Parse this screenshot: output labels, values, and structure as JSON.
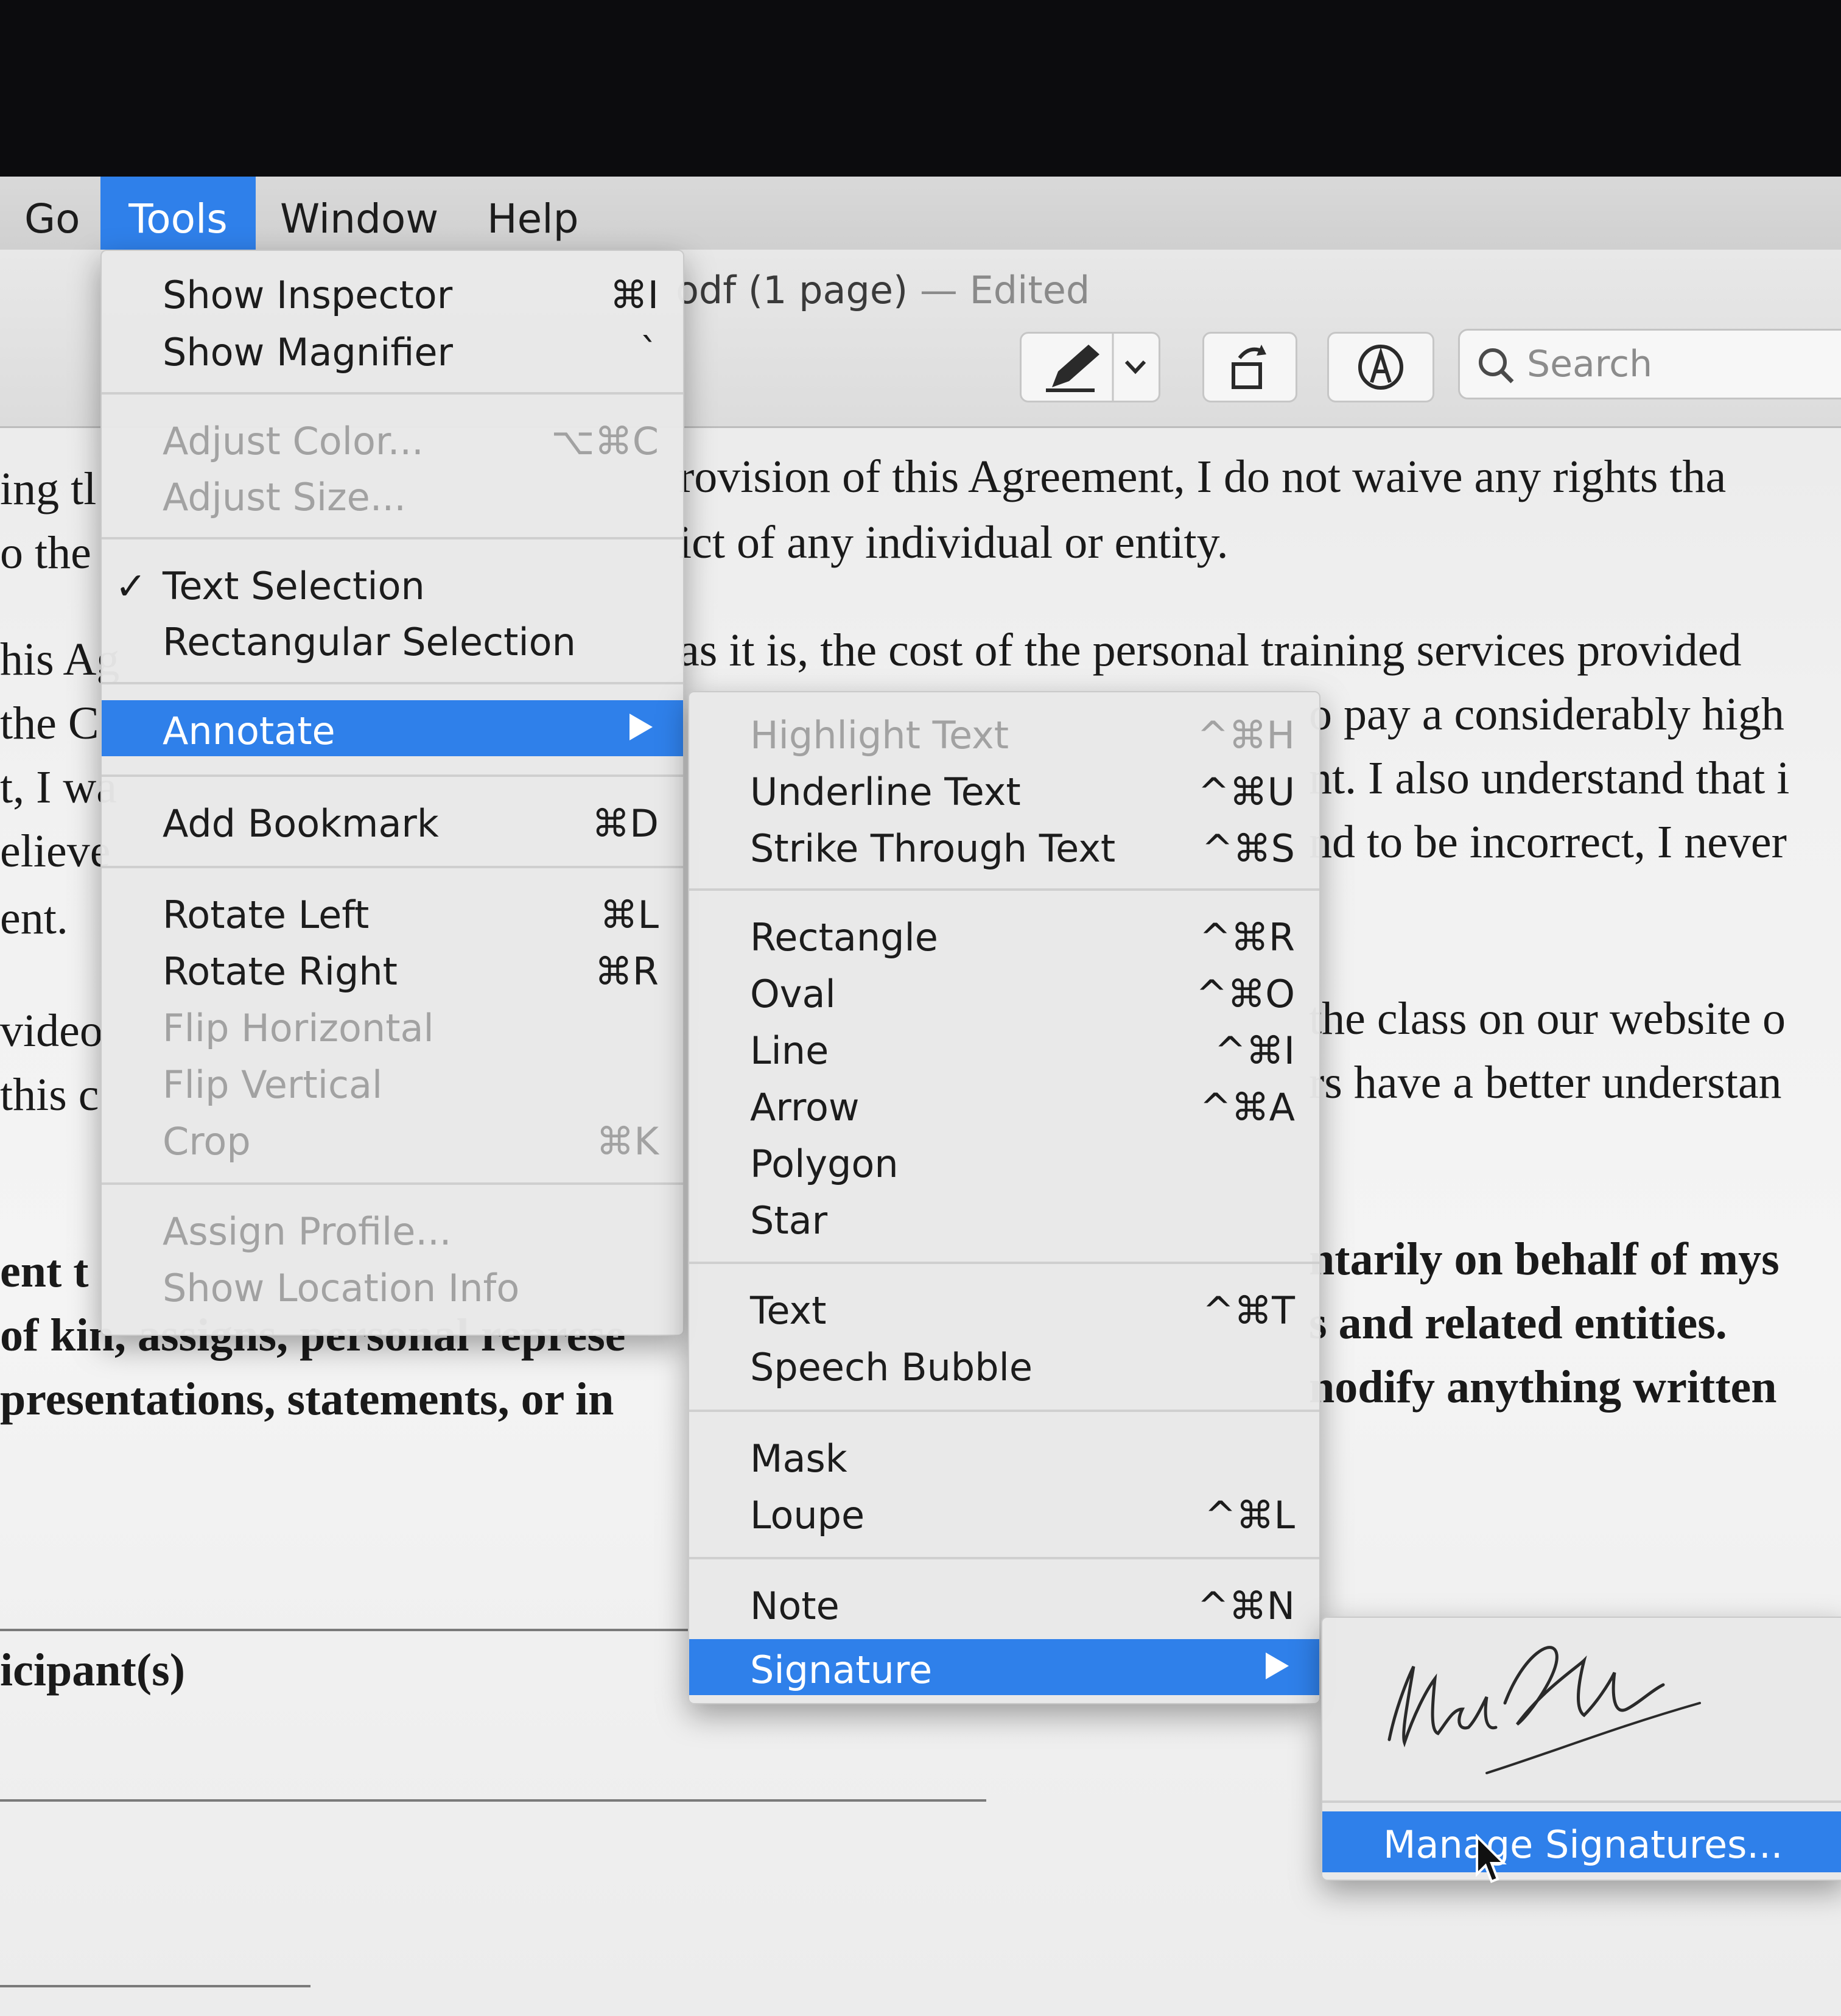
{
  "menubar": {
    "items": [
      {
        "label": "Go"
      },
      {
        "label": "Tools"
      },
      {
        "label": "Window"
      },
      {
        "label": "Help"
      }
    ]
  },
  "window": {
    "title": "odf (1 page)",
    "title_status": "— Edited",
    "search_placeholder": "Search"
  },
  "document": {
    "lines": [
      "rovision of this Agreement, I do not waive any rights tha",
      "ict of any individual or entity.",
      "as it is, the cost of the personal training services provided",
      "o pay a considerably high",
      "nt.  I also understand that i",
      "nd to be incorrect, I never",
      "the class on our website o",
      "rs have a better understan",
      "ntarily on behalf of mys",
      "s and related entities.",
      "nodify anything written",
      "ing tl",
      "o the",
      "his Ag",
      "the C",
      "t, I wa",
      "elieve",
      "ent.",
      "video",
      "this c",
      "ent t",
      "of kin, assigns, personal represe",
      "presentations, statements, or in",
      "icipant(s)"
    ]
  },
  "tools_menu": {
    "items": [
      {
        "label": "Show Inspector",
        "shortcut": "⌘I",
        "enabled": true
      },
      {
        "label": "Show Magnifier",
        "shortcut": "`",
        "enabled": true
      },
      {
        "label": "Adjust Color...",
        "shortcut": "⌥⌘C",
        "enabled": false
      },
      {
        "label": "Adjust Size...",
        "shortcut": "",
        "enabled": false
      },
      {
        "label": "Text Selection",
        "shortcut": "",
        "enabled": true,
        "checked": true
      },
      {
        "label": "Rectangular Selection",
        "shortcut": "",
        "enabled": true
      },
      {
        "label": "Annotate",
        "shortcut": "",
        "enabled": true,
        "highlighted": true
      },
      {
        "label": "Add Bookmark",
        "shortcut": "⌘D",
        "enabled": true
      },
      {
        "label": "Rotate Left",
        "shortcut": "⌘L",
        "enabled": true
      },
      {
        "label": "Rotate Right",
        "shortcut": "⌘R",
        "enabled": true
      },
      {
        "label": "Flip Horizontal",
        "shortcut": "",
        "enabled": false
      },
      {
        "label": "Flip Vertical",
        "shortcut": "",
        "enabled": false
      },
      {
        "label": "Crop",
        "shortcut": "⌘K",
        "enabled": false
      },
      {
        "label": "Assign Profile...",
        "shortcut": "",
        "enabled": false
      },
      {
        "label": "Show Location Info",
        "shortcut": "",
        "enabled": false
      }
    ]
  },
  "annotate_menu": {
    "items": [
      {
        "label": "Highlight Text",
        "shortcut": "^⌘H",
        "enabled": false
      },
      {
        "label": "Underline Text",
        "shortcut": "^⌘U",
        "enabled": true
      },
      {
        "label": "Strike Through Text",
        "shortcut": "^⌘S",
        "enabled": true
      },
      {
        "label": "Rectangle",
        "shortcut": "^⌘R",
        "enabled": true
      },
      {
        "label": "Oval",
        "shortcut": "^⌘O",
        "enabled": true
      },
      {
        "label": "Line",
        "shortcut": "^⌘I",
        "enabled": true
      },
      {
        "label": "Arrow",
        "shortcut": "^⌘A",
        "enabled": true
      },
      {
        "label": "Polygon",
        "shortcut": "",
        "enabled": true
      },
      {
        "label": "Star",
        "shortcut": "",
        "enabled": true
      },
      {
        "label": "Text",
        "shortcut": "^⌘T",
        "enabled": true
      },
      {
        "label": "Speech Bubble",
        "shortcut": "",
        "enabled": true
      },
      {
        "label": "Mask",
        "shortcut": "",
        "enabled": true
      },
      {
        "label": "Loupe",
        "shortcut": "^⌘L",
        "enabled": true
      },
      {
        "label": "Note",
        "shortcut": "^⌘N",
        "enabled": true
      },
      {
        "label": "Signature",
        "shortcut": "",
        "enabled": true,
        "highlighted": true
      }
    ]
  },
  "signature_menu": {
    "manage_label": "Manage Signatures..."
  },
  "colors": {
    "accent": "#2f80ea",
    "disabled_text": "#a2a2a2"
  }
}
